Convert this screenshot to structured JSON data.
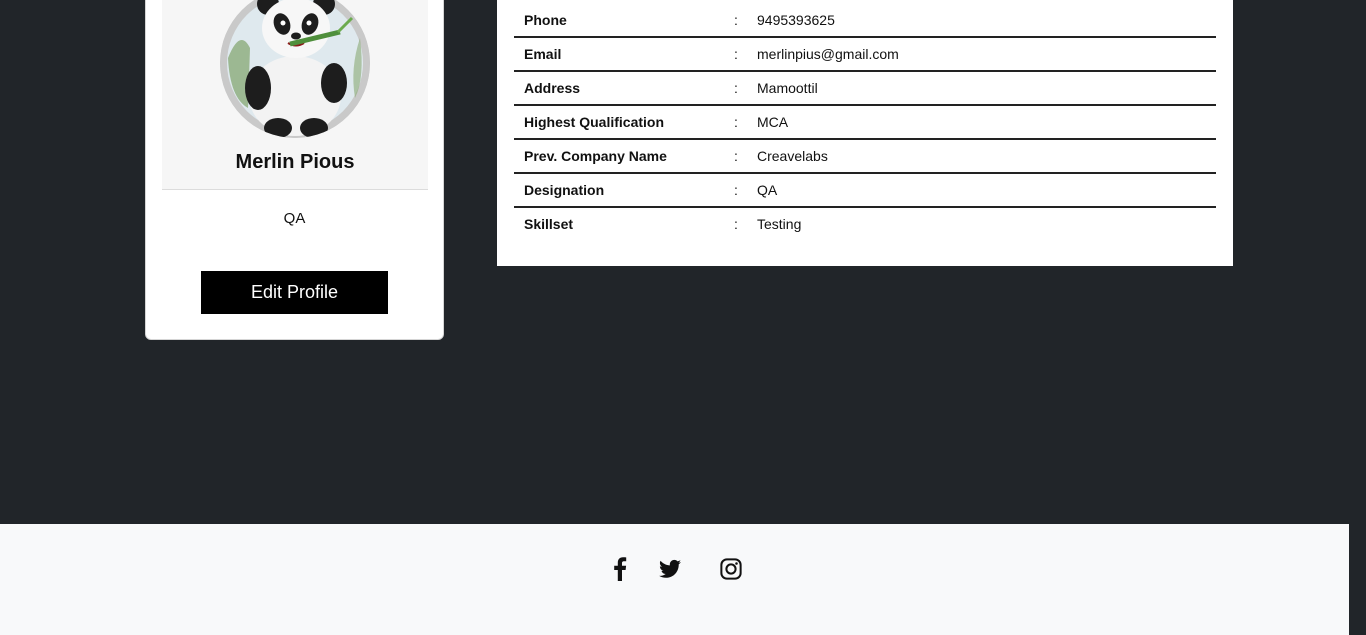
{
  "profile": {
    "name": "Merlin Pious",
    "role": "QA",
    "edit_label": "Edit Profile"
  },
  "details": [
    {
      "label": "Phone",
      "sep": ":",
      "value": "9495393625"
    },
    {
      "label": "Email",
      "sep": ":",
      "value": "merlinpius@gmail.com"
    },
    {
      "label": "Address",
      "sep": ":",
      "value": "Mamoottil"
    },
    {
      "label": "Highest Qualification",
      "sep": ":",
      "value": "MCA"
    },
    {
      "label": "Prev. Company Name",
      "sep": ":",
      "value": "Creavelabs"
    },
    {
      "label": "Designation",
      "sep": ":",
      "value": "QA"
    },
    {
      "label": "Skillset",
      "sep": ":",
      "value": "Testing"
    }
  ],
  "footer": {
    "icons": [
      "facebook-icon",
      "twitter-icon",
      "instagram-icon"
    ]
  },
  "colors": {
    "background": "#212529",
    "footer": "#f8f9fa",
    "button": "#000000"
  }
}
